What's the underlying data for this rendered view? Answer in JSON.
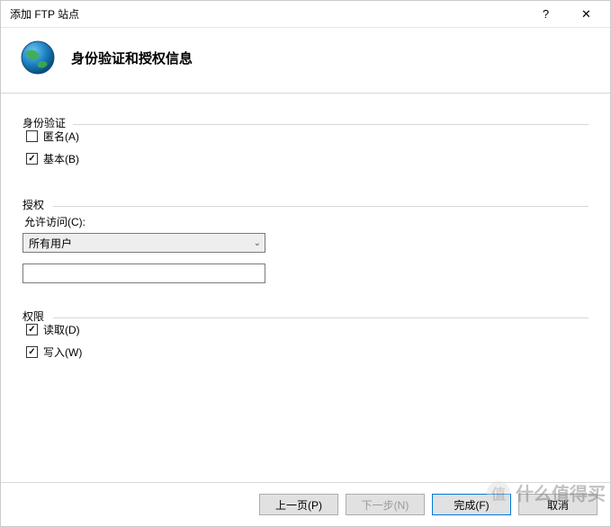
{
  "window": {
    "title": "添加 FTP 站点",
    "help_symbol": "?",
    "close_symbol": "✕"
  },
  "header": {
    "page_title": "身份验证和授权信息"
  },
  "auth": {
    "group_label": "身份验证",
    "anonymous_label": "匿名(A)",
    "anonymous_checked": false,
    "basic_label": "基本(B)",
    "basic_checked": true
  },
  "authz": {
    "group_label": "授权",
    "allow_access_label": "允许访问(C):",
    "selected_option": "所有用户",
    "extra_input_value": ""
  },
  "perm": {
    "group_label": "权限",
    "read_label": "读取(D)",
    "read_checked": true,
    "write_label": "写入(W)",
    "write_checked": true
  },
  "footer": {
    "prev": "上一页(P)",
    "next": "下一步(N)",
    "finish": "完成(F)",
    "cancel": "取消"
  },
  "watermark": {
    "text": "什么值得买"
  }
}
